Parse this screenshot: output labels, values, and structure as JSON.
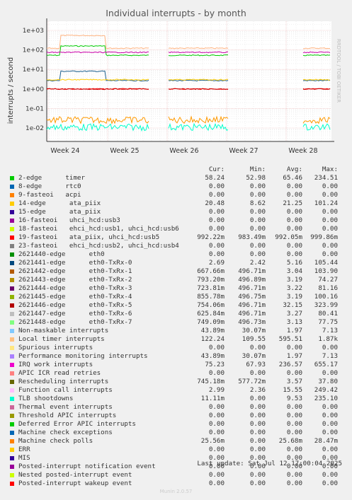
{
  "title": "Individual interrupts - by month",
  "credit": "RRDTOOL / TOBI OETIKER",
  "footer": "Munin 2.0.57",
  "last_update": "Last update: Sat Jul 12 17:00:04 2025",
  "colors": {
    "background": "#f0f0f0",
    "plot_bg": "#ffffff",
    "grid_major": "#e8b0b0",
    "grid_minor": "#e0e0e0"
  },
  "chart_data": {
    "type": "line",
    "title": "Individual interrupts - by month",
    "ylabel": "interrupts / second",
    "yscale": "log",
    "ylim": [
      0.003,
      3000
    ],
    "y_ticks": [
      "1e+03",
      "1e+02",
      "1e+01",
      "1e+00",
      "1e-01",
      "1e-02"
    ],
    "x_ticks": [
      "Week 24",
      "Week 25",
      "Week 26",
      "Week 27",
      "Week 28"
    ],
    "grid": true,
    "data_gaps": [
      "between Week 25 and Week 26",
      "most of Week 27"
    ],
    "series": [
      {
        "name": "timer",
        "color": "#00cc00",
        "level": 52.98
      },
      {
        "name": "Local timer interrupts",
        "color": "#ffb380",
        "level": 122.24
      },
      {
        "name": "eth0-TxRx-0 (2621441-edge)",
        "color": "#1a5e8c",
        "level": 2.69
      },
      {
        "name": "Posted-interrupt wakeup event",
        "color": "#ff0000",
        "level": 1.0
      },
      {
        "name": "19-fasteoi",
        "color": "#cc0000",
        "level": 0.992
      },
      {
        "name": "TLB shootdowns",
        "color": "#00ffcc",
        "level": 0.011
      },
      {
        "name": "Function call interrupts",
        "color": "#ffcc00",
        "level": 2.99
      },
      {
        "name": "Machine check polls",
        "color": "#ff9900",
        "level": 0.0256
      },
      {
        "name": "IRQ work interrupts",
        "color": "#cc00aa",
        "level": 75.23
      }
    ]
  },
  "legend": {
    "headers": [
      "Cur:",
      "Min:",
      "Avg:",
      "Max:"
    ],
    "rows": [
      {
        "name": "2-edge      timer",
        "color": "#00cc00",
        "cur": "58.24",
        "min": "52.98",
        "avg": "65.46",
        "max": "234.51"
      },
      {
        "name": "8-edge      rtc0",
        "color": "#0066b3",
        "cur": "0.00",
        "min": "0.00",
        "avg": "0.00",
        "max": "0.00"
      },
      {
        "name": "9-fasteoi   acpi",
        "color": "#ff8000",
        "cur": "0.00",
        "min": "0.00",
        "avg": "0.00",
        "max": "0.00"
      },
      {
        "name": "14-edge      ata_piix",
        "color": "#ffcc00",
        "cur": "20.48",
        "min": "8.62",
        "avg": "21.25",
        "max": "101.24"
      },
      {
        "name": "15-edge      ata_piix",
        "color": "#330099",
        "cur": "0.00",
        "min": "0.00",
        "avg": "0.00",
        "max": "0.00"
      },
      {
        "name": "16-fasteoi   uhci_hcd:usb3",
        "color": "#990099",
        "cur": "0.00",
        "min": "0.00",
        "avg": "0.00",
        "max": "0.00"
      },
      {
        "name": "18-fasteoi   ehci_hcd:usb1, uhci_hcd:usb6",
        "color": "#ccff00",
        "cur": "0.00",
        "min": "0.00",
        "avg": "0.00",
        "max": "0.00"
      },
      {
        "name": "19-fasteoi   ata_piix, uhci_hcd:usb5",
        "color": "#ff0000",
        "cur": "992.22m",
        "min": "983.49m",
        "avg": "992.05m",
        "max": "999.86m"
      },
      {
        "name": "23-fasteoi   ehci_hcd:usb2, uhci_hcd:usb4",
        "color": "#808080",
        "cur": "0.00",
        "min": "0.00",
        "avg": "0.00",
        "max": "0.00"
      },
      {
        "name": "2621440-edge      eth0",
        "color": "#008f00",
        "cur": "0.00",
        "min": "0.00",
        "avg": "0.00",
        "max": "0.00"
      },
      {
        "name": "2621441-edge      eth0-TxRx-0",
        "color": "#00487d",
        "cur": "2.69",
        "min": "2.42",
        "avg": "5.16",
        "max": "105.44"
      },
      {
        "name": "2621442-edge      eth0-TxRx-1",
        "color": "#b35a00",
        "cur": "667.66m",
        "min": "496.71m",
        "avg": "3.04",
        "max": "103.90"
      },
      {
        "name": "2621443-edge      eth0-TxRx-2",
        "color": "#b38f00",
        "cur": "793.20m",
        "min": "496.89m",
        "avg": "3.19",
        "max": "74.27"
      },
      {
        "name": "2621444-edge      eth0-TxRx-3",
        "color": "#6b006b",
        "cur": "723.81m",
        "min": "496.71m",
        "avg": "3.22",
        "max": "81.16"
      },
      {
        "name": "2621445-edge      eth0-TxRx-4",
        "color": "#8fb300",
        "cur": "855.78m",
        "min": "496.75m",
        "avg": "3.19",
        "max": "100.16"
      },
      {
        "name": "2621446-edge      eth0-TxRx-5",
        "color": "#b30000",
        "cur": "754.06m",
        "min": "496.71m",
        "avg": "32.15",
        "max": "323.99"
      },
      {
        "name": "2621447-edge      eth0-TxRx-6",
        "color": "#bebebe",
        "cur": "625.84m",
        "min": "496.71m",
        "avg": "3.27",
        "max": "80.41"
      },
      {
        "name": "2621448-edge      eth0-TxRx-7",
        "color": "#80ff80",
        "cur": "749.09m",
        "min": "496.73m",
        "avg": "3.13",
        "max": "77.75"
      },
      {
        "name": "Non-maskable interrupts",
        "color": "#80c9ff",
        "cur": "43.89m",
        "min": "30.07m",
        "avg": "1.97",
        "max": "7.13"
      },
      {
        "name": "Local timer interrupts",
        "color": "#ffc080",
        "cur": "122.24",
        "min": "109.55",
        "avg": "595.51",
        "max": "1.87k"
      },
      {
        "name": "Spurious interrupts",
        "color": "#ffe680",
        "cur": "0.00",
        "min": "0.00",
        "avg": "0.00",
        "max": "0.00"
      },
      {
        "name": "Performance monitoring interrupts",
        "color": "#aa80ff",
        "cur": "43.89m",
        "min": "30.07m",
        "avg": "1.97",
        "max": "7.13"
      },
      {
        "name": "IRQ work interrupts",
        "color": "#ee00cc",
        "cur": "75.23",
        "min": "67.93",
        "avg": "236.57",
        "max": "655.17"
      },
      {
        "name": "APIC ICR read retries",
        "color": "#ff8080",
        "cur": "0.00",
        "min": "0.00",
        "avg": "0.00",
        "max": "0.00"
      },
      {
        "name": "Rescheduling interrupts",
        "color": "#666600",
        "cur": "745.18m",
        "min": "577.72m",
        "avg": "3.57",
        "max": "37.80"
      },
      {
        "name": "Function call interrupts",
        "color": "#ffbfff",
        "cur": "2.99",
        "min": "2.36",
        "avg": "15.55",
        "max": "249.42"
      },
      {
        "name": "TLB shootdowns",
        "color": "#00ffcc",
        "cur": "11.11m",
        "min": "0.00",
        "avg": "9.53",
        "max": "235.10"
      },
      {
        "name": "Thermal event interrupts",
        "color": "#cc6699",
        "cur": "0.00",
        "min": "0.00",
        "avg": "0.00",
        "max": "0.00"
      },
      {
        "name": "Threshold APIC interrupts",
        "color": "#999900",
        "cur": "0.00",
        "min": "0.00",
        "avg": "0.00",
        "max": "0.00"
      },
      {
        "name": "Deferred Error APIC interrupts",
        "color": "#00cc00",
        "cur": "0.00",
        "min": "0.00",
        "avg": "0.00",
        "max": "0.00"
      },
      {
        "name": "Machine check exceptions",
        "color": "#0066b3",
        "cur": "0.00",
        "min": "0.00",
        "avg": "0.00",
        "max": "0.00"
      },
      {
        "name": "Machine check polls",
        "color": "#ff8000",
        "cur": "25.56m",
        "min": "0.00",
        "avg": "25.68m",
        "max": "28.47m"
      },
      {
        "name": "ERR",
        "color": "#ffcc00",
        "cur": "0.00",
        "min": "0.00",
        "avg": "0.00",
        "max": "0.00"
      },
      {
        "name": "MIS",
        "color": "#330099",
        "cur": "0.00",
        "min": "0.00",
        "avg": "0.00",
        "max": "0.00"
      },
      {
        "name": "Posted-interrupt notification event",
        "color": "#990099",
        "cur": "0.00",
        "min": "0.00",
        "avg": "0.00",
        "max": "0.00"
      },
      {
        "name": "Nested posted-interrupt event",
        "color": "#ccff00",
        "cur": "0.00",
        "min": "0.00",
        "avg": "0.00",
        "max": "0.00"
      },
      {
        "name": "Posted-interrupt wakeup event",
        "color": "#ff0000",
        "cur": "0.00",
        "min": "0.00",
        "avg": "0.00",
        "max": "0.00"
      }
    ]
  }
}
